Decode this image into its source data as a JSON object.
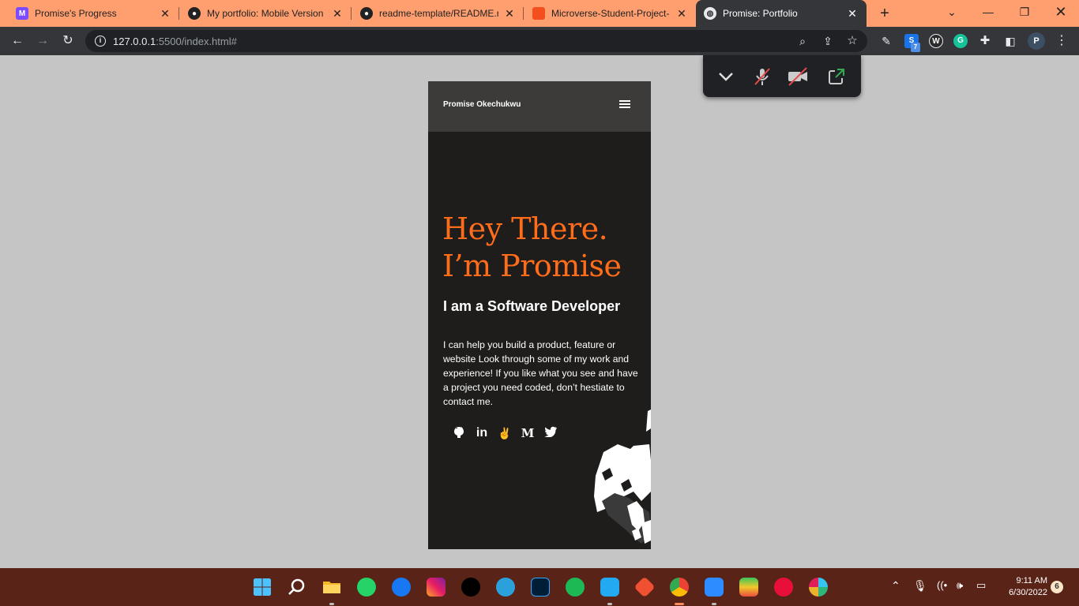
{
  "browser": {
    "tabs": [
      {
        "title": "Promise's Progress",
        "active": false,
        "favicon": "progress-icon",
        "favicon_color": "#7a4bff"
      },
      {
        "title": "My portfolio: Mobile Version",
        "active": false,
        "favicon": "github-icon",
        "favicon_color": "#222222"
      },
      {
        "title": "readme-template/README.md",
        "active": false,
        "favicon": "github-icon",
        "favicon_color": "#222222"
      },
      {
        "title": "Microverse-Student-Project-",
        "active": false,
        "favicon": "figma-icon",
        "favicon_color": "#f24e1e"
      },
      {
        "title": "Promise: Portfolio",
        "active": true,
        "favicon": "globe-icon",
        "favicon_color": "#ffffff"
      }
    ],
    "address": {
      "host": "127.0.0.1",
      "path": ":5500/index.html#"
    },
    "profile_initial": "P",
    "extension_badge": "7"
  },
  "page": {
    "nav": {
      "brand": "Promise Okechukwu",
      "menu_icon": "hamburger-icon"
    },
    "hero": {
      "heading_line1": "Hey There.",
      "heading_line2": "I’m Promise",
      "subheading": "I am a Software Developer",
      "intro": "I can help you build a product, feature or website Look through some of my work and experience! If you like what you see and have a project you need coded, don’t hestiate to contact me."
    },
    "social": [
      {
        "name": "github-icon",
        "glyph": "🐱"
      },
      {
        "name": "linkedin-icon",
        "glyph": "in"
      },
      {
        "name": "angellist-icon",
        "glyph": "✌"
      },
      {
        "name": "medium-icon",
        "glyph": "M"
      },
      {
        "name": "twitter-icon",
        "glyph": "🐦"
      }
    ],
    "accent_color": "#ff6c1a"
  },
  "taskbar": {
    "time": "9:11 AM",
    "date": "6/30/2022",
    "notification_count": "6"
  }
}
